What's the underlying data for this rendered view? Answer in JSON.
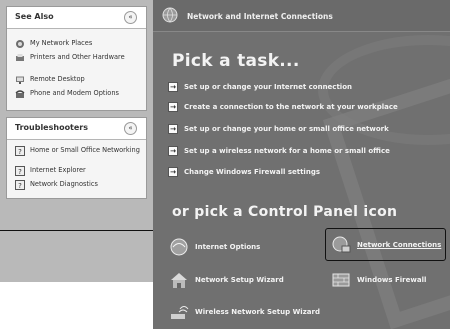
{
  "see_also": {
    "title": "See Also",
    "items": [
      {
        "label": "My Network Places",
        "icon": "network-places-icon"
      },
      {
        "label": "Printers and Other Hardware",
        "icon": "printer-icon"
      },
      {
        "label": "Remote Desktop",
        "icon": "remote-desktop-icon"
      },
      {
        "label": "Phone and Modem Options",
        "icon": "phone-icon"
      }
    ]
  },
  "troubleshooters": {
    "title": "Troubleshooters",
    "items": [
      {
        "label": "Home or Small Office Networking",
        "icon": "help-icon"
      },
      {
        "label": "Internet Explorer",
        "icon": "help-icon"
      },
      {
        "label": "Network Diagnostics",
        "icon": "help-icon"
      }
    ]
  },
  "header": {
    "title": "Network and Internet Connections",
    "icon": "network-globe-icon"
  },
  "pick_task": {
    "heading": "Pick a task...",
    "tasks": [
      "Set up or change your Internet connection",
      "Create a connection to the network at your workplace",
      "Set up or change your home or small office network",
      "Set up a wireless network for a home or small office",
      "Change Windows Firewall settings"
    ]
  },
  "control_panel": {
    "heading": "or pick a Control Panel icon",
    "icons": [
      {
        "label": "Internet Options",
        "icon": "internet-options-icon"
      },
      {
        "label": "Network Connections",
        "icon": "network-connections-icon",
        "highlighted": true
      },
      {
        "label": "Network Setup Wizard",
        "icon": "house-icon"
      },
      {
        "label": "Windows Firewall",
        "icon": "firewall-icon"
      },
      {
        "label": "Wireless Network Setup Wizard",
        "icon": "wireless-icon"
      }
    ]
  },
  "colors": {
    "panel_bg": "#707070",
    "sidebar_bg": "#b9b9b9",
    "text_light": "#f3f3f3"
  }
}
